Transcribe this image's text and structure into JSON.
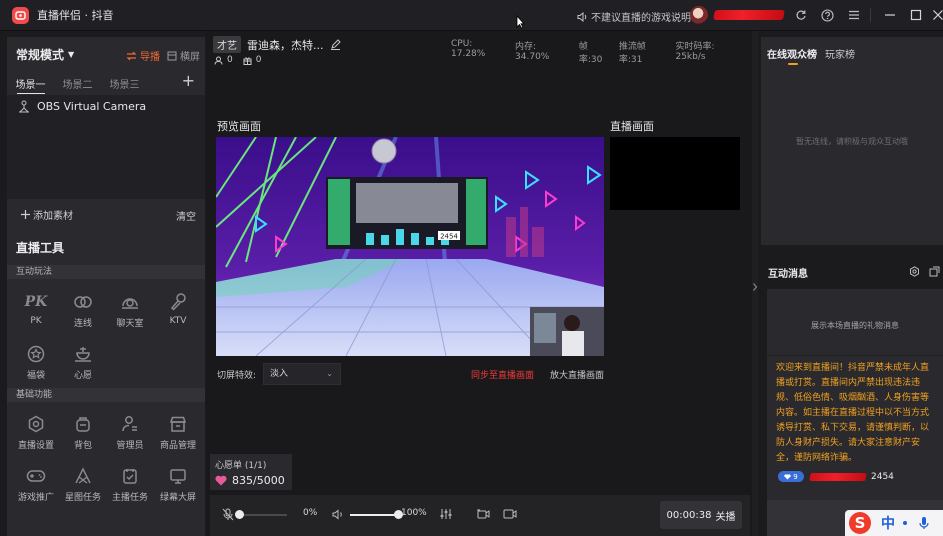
{
  "app": {
    "title": "直播伴侣 · 抖音"
  },
  "titlebar": {
    "warning": "不建议直播的游戏说明"
  },
  "left": {
    "mode": "常规模式",
    "guide": "导播",
    "landscape": "横屏",
    "scene_tabs": [
      "场景一",
      "场景二",
      "场景三"
    ],
    "sources": [
      {
        "label": "OBS Virtual Camera"
      }
    ],
    "add_source": "添加素材",
    "clear": "清空",
    "tools_title": "直播工具",
    "section_interactive": "互动玩法",
    "interactive_tools": [
      "PK",
      "连线",
      "聊天室",
      "KTV",
      "福袋",
      "心愿"
    ],
    "section_basic": "基础功能",
    "basic_tools": [
      "直播设置",
      "背包",
      "管理员",
      "商品管理",
      "游戏推广",
      "星图任务",
      "主播任务",
      "绿幕大屏"
    ]
  },
  "center": {
    "anchor_tag": "才艺",
    "anchor_name": "雷迪森，杰特...",
    "likes": "0",
    "gifts": "0",
    "perf": {
      "cpu": "CPU: 17.28%",
      "mem": "内存: 34.70%",
      "fps": "帧率:30",
      "push_fps": "推流帧率:31",
      "bitrate": "实时码率: 25kb/s"
    },
    "preview_label": "预览画面",
    "live_label": "直播画面",
    "switch_label": "切屏特效:",
    "switch_value": "淡入",
    "sync_link": "同步至直播画面",
    "enlarge_link": "放大直播画面",
    "wish_title": "心愿单 (1/1)",
    "wish_value": "835/5000",
    "scene_score": "2454",
    "mic_level": 0.0,
    "mic_pct": "0%",
    "speaker_level": 1.0,
    "speaker_pct": "100%",
    "timer": "00:00:38",
    "close_label": "关播"
  },
  "right": {
    "tab_online": "在线观众榜",
    "tab_fans": "玩家榜",
    "viewer_empty": "暂无连线，请积极与观众互动哦",
    "messages_title": "互动消息",
    "gift_hint": "展示本场直播的礼物消息",
    "welcome": "欢迎来到直播间！抖音严禁未成年人直播或打赏。直播间内严禁出现违法违规、低俗色情、吸烟酗酒、人身伤害等内容。如主播在直播过程中以不当方式诱导打赏、私下交易，请谨慎判断，以防人身财产损失。请大家注意财产安全，谨防网络诈骗。",
    "visitor_badge": "9",
    "visitor_score": "2454"
  },
  "ime": {
    "label": "中"
  },
  "colors": {
    "accent_orange": "#f0a020",
    "accent_red": "#f23a3a",
    "guide_orange": "#f26a30"
  }
}
